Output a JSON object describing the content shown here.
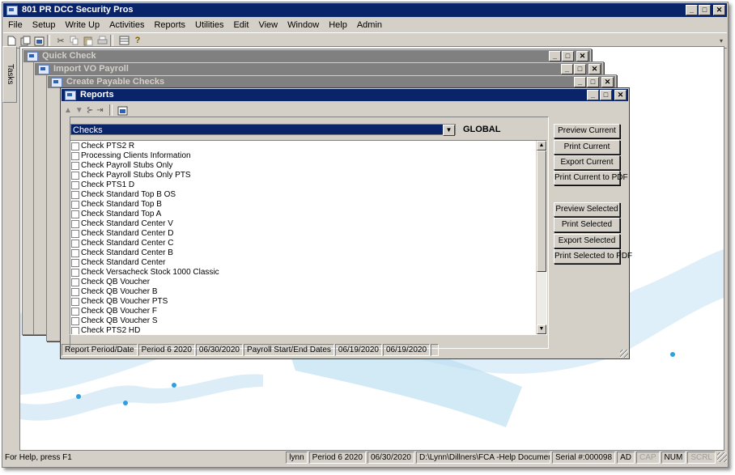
{
  "app": {
    "title": "801 PR DCC Security Pros",
    "tasks_label": "Tasks",
    "menu": [
      "File",
      "Setup",
      "Write Up",
      "Activities",
      "Reports",
      "Utilities",
      "Edit",
      "View",
      "Window",
      "Help",
      "Admin"
    ],
    "window_buttons": {
      "minimize": "_",
      "maximize": "□",
      "close": "✕"
    }
  },
  "child_windows": [
    {
      "title": "Quick Check"
    },
    {
      "title": "Import VO Payroll"
    },
    {
      "title": "Create Payable Checks"
    }
  ],
  "reports": {
    "title": "Reports",
    "category": "Checks",
    "scope_label": "GLOBAL",
    "items": [
      "Check PTS2 R",
      "Processing Clients Information",
      "Check Payroll Stubs Only",
      "Check Payroll Stubs Only PTS",
      "Check PTS1 D",
      "Check Standard Top B OS",
      "Check Standard Top B",
      "Check Standard Top A",
      "Check Standard Center V",
      "Check Standard Center D",
      "Check Standard Center C",
      "Check Standard Center B",
      "Check Standard Center",
      "Check Versacheck Stock 1000 Classic",
      "Check QB Voucher",
      "Check QB Voucher B",
      "Check QB Voucher PTS",
      "Check QB Voucher F",
      "Check QB Voucher S",
      "Check PTS2 HD"
    ],
    "buttons": {
      "preview_current": "Preview Current",
      "print_current": "Print Current",
      "export_current": "Export Current",
      "print_current_pdf": "Print Current to PDF",
      "preview_selected": "Preview Selected",
      "print_selected": "Print Selected",
      "export_selected": "Export Selected",
      "print_selected_pdf": "Print Selected to PDF"
    },
    "status": {
      "report_period_label": "Report Period/Date",
      "period": "Period 6 2020",
      "period_date": "06/30/2020",
      "payroll_label": "Payroll Start/End Dates",
      "start_date": "06/19/2020",
      "end_date": "06/19/2020"
    }
  },
  "statusbar": {
    "help": "For Help, press F1",
    "user": "lynn",
    "period": "Period 6 2020",
    "date": "06/30/2020",
    "path": "D:\\Lynn\\Dillners\\FCA -Help Documentation\\",
    "serial": "Serial #:000098",
    "ad": "AD",
    "cap": "CAP",
    "num": "NUM",
    "scrl": "SCRL"
  },
  "colors": {
    "active_title": "#0a246a",
    "inactive_title": "#808080",
    "face": "#d4d0c8",
    "wave": "#bfe0f2",
    "dot": "#2e9fe0"
  }
}
